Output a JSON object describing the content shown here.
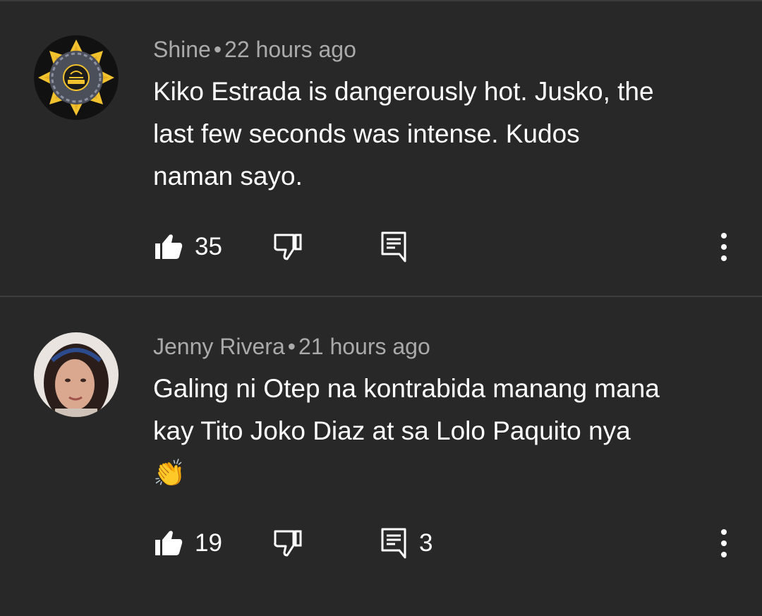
{
  "comments": [
    {
      "author": "Shine",
      "separator": "•",
      "time": "22 hours ago",
      "lines": [
        "Kiko Estrada is dangerously hot. Jusko, the",
        "last few seconds was intense. Kudos",
        "naman sayo."
      ],
      "likes": "35",
      "replies": ""
    },
    {
      "author": "Jenny Rivera",
      "separator": "•",
      "time": "21 hours ago",
      "lines": [
        "Galing ni Otep na kontrabida manang mana",
        "kay Tito Joko Diaz at sa Lolo Paquito nya",
        "👏"
      ],
      "likes": "19",
      "replies": "3"
    }
  ],
  "icons": {
    "like": "thumb-up-icon",
    "dislike": "thumb-down-icon",
    "reply": "comment-icon",
    "more": "more-vert-icon"
  },
  "colors": {
    "background": "#282828",
    "meta_text": "#aaaaaa",
    "body_text": "#ffffff",
    "avatar_gold": "#f2c12e"
  }
}
